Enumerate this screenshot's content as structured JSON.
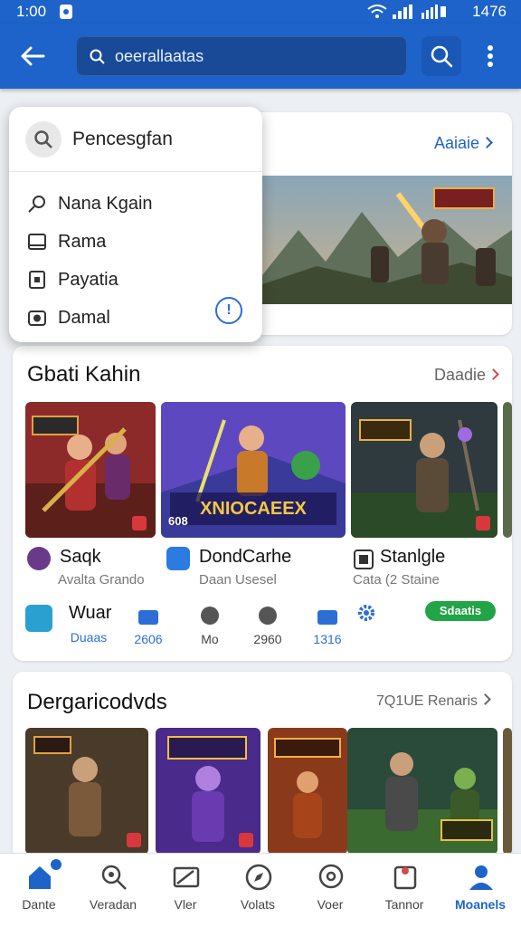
{
  "status_bar": {
    "time": "1:00",
    "battery": "1476"
  },
  "app_bar": {
    "search_placeholder": "oeerallaatas"
  },
  "dropdown": {
    "title": "Pencesgfan",
    "items": [
      {
        "label": "Nana Kgain",
        "icon": "search-icon"
      },
      {
        "label": "Rama",
        "icon": "tablet-icon"
      },
      {
        "label": "Payatia",
        "icon": "file-icon"
      },
      {
        "label": "Damal",
        "icon": "camera-icon"
      }
    ]
  },
  "featured": {
    "link": "Aaiaie"
  },
  "section1": {
    "title": "Gbati Kahin",
    "link": "Daadie",
    "apps": [
      {
        "name": "Saqk",
        "sub": "Avalta Grando",
        "tag": ""
      },
      {
        "name": "DondCarhe",
        "sub": "Daan Usesel",
        "tag": "608"
      },
      {
        "name": "Stanlgle",
        "sub": "Cata (2 Staine",
        "tag": ""
      }
    ],
    "thumb_titles": [
      "",
      "XNIOCAEEX",
      ""
    ],
    "stats_label": "Wuar",
    "stats": [
      {
        "label": "Duaas"
      },
      {
        "label": "2606"
      },
      {
        "label": "Mo"
      },
      {
        "label": "2960"
      },
      {
        "label": "1316"
      }
    ],
    "pill": "Sdaatis"
  },
  "section2": {
    "title": "Dergaricodvds",
    "link": "7Q1UE Renaris"
  },
  "bottom_nav": [
    {
      "label": "Dante",
      "icon": "home-icon",
      "active": false
    },
    {
      "label": "Veradan",
      "icon": "search-icon",
      "active": false
    },
    {
      "label": "Vler",
      "icon": "image-icon",
      "active": false
    },
    {
      "label": "Volats",
      "icon": "compass-icon",
      "active": false
    },
    {
      "label": "Voer",
      "icon": "chat-icon",
      "active": false
    },
    {
      "label": "Tannor",
      "icon": "bell-icon",
      "active": false
    },
    {
      "label": "Moanels",
      "icon": "profile-icon",
      "active": true
    }
  ],
  "colors": {
    "primary": "#1d63c9",
    "success": "#22a447",
    "accent_red": "#d54a4a"
  }
}
